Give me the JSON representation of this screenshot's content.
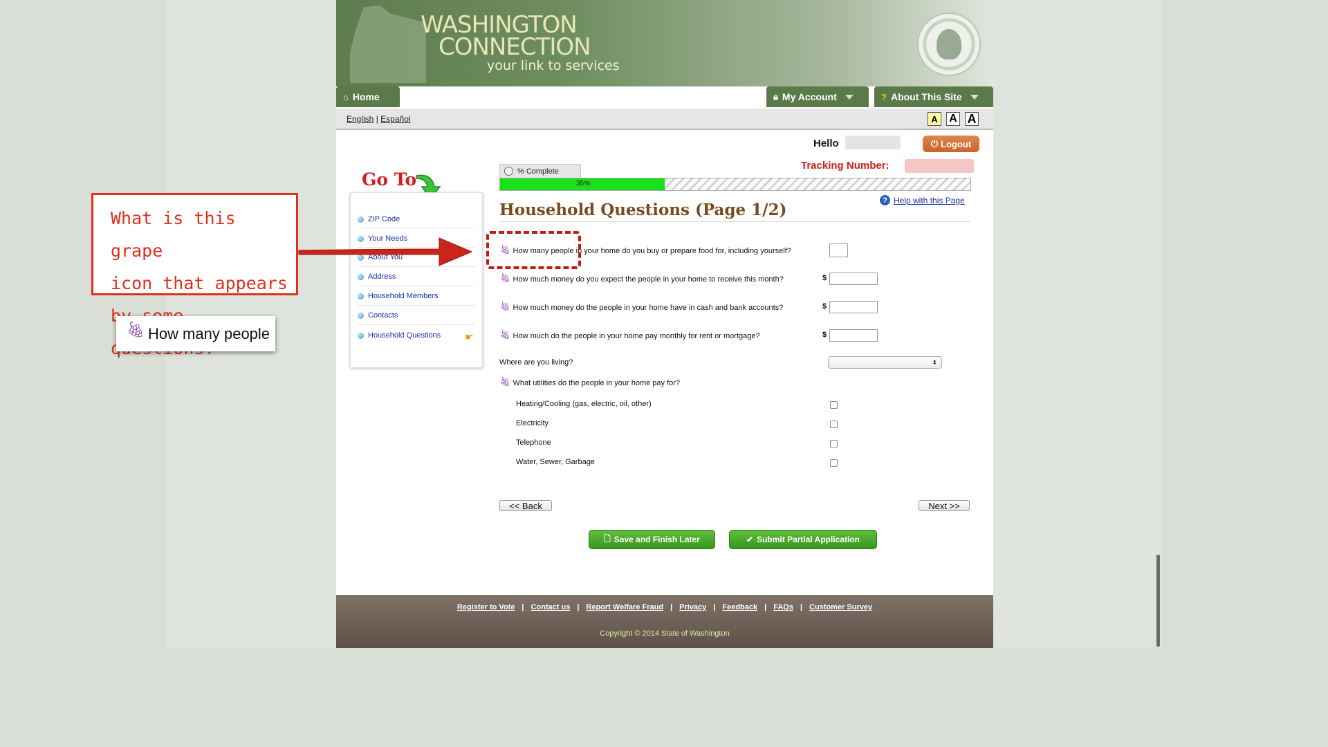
{
  "header": {
    "logo_line1": "WASHINGTON",
    "logo_line2": "CONNECTION",
    "logo_tagline": "your link to services",
    "seal_text": "THE SEAL OF THE STATE OF WASHINGTON 1889"
  },
  "nav": {
    "home": "Home",
    "my_account": "My Account",
    "about": "About This Site"
  },
  "lang": {
    "english": "English",
    "separator": "|",
    "spanish": "Español"
  },
  "text_size": [
    "A",
    "A",
    "A"
  ],
  "user": {
    "hello": "Hello",
    "logout": "Logout",
    "tracking_label": "Tracking Number:"
  },
  "sidebar": {
    "goto": "Go To",
    "items": [
      {
        "label": "ZIP Code"
      },
      {
        "label": "Your Needs"
      },
      {
        "label": "About You"
      },
      {
        "label": "Address"
      },
      {
        "label": "Household Members"
      },
      {
        "label": "Contacts"
      },
      {
        "label": "Household Questions"
      }
    ]
  },
  "progress": {
    "tab_label": "% Complete",
    "value_text": "35%",
    "fraction": 0.35
  },
  "help_link": "Help with this Page",
  "page_title": "Household Questions (Page 1/2)",
  "questions": [
    {
      "text": "How many people in your home do you buy or prepare food for, including yourself?"
    },
    {
      "text": "How much money do you expect the people in your home to receive this month?",
      "prefix": "$"
    },
    {
      "text": "How much money do the people in your home have in cash and bank accounts?",
      "prefix": "$"
    },
    {
      "text": "How much do the people in your home pay monthly for rent or mortgage?",
      "prefix": "$"
    }
  ],
  "living": {
    "label": "Where are you living?",
    "selected": ""
  },
  "utilities": {
    "label": "What utilities do the people in your home pay for?",
    "options": [
      {
        "label": "Heating/Cooling (gas, electric, oil, other)",
        "checked": false
      },
      {
        "label": "Electricity",
        "checked": false
      },
      {
        "label": "Telephone",
        "checked": false
      },
      {
        "label": "Water, Sewer, Garbage",
        "checked": false
      }
    ]
  },
  "buttons": {
    "back": "<< Back",
    "next": "Next >>",
    "save": "Save and Finish Later",
    "submit": "Submit Partial Application"
  },
  "footer": {
    "links": [
      "Register to Vote",
      "Contact us",
      "Report Welfare Fraud",
      "Privacy",
      "Feedback",
      "FAQs",
      "Customer Survey"
    ],
    "separator": "|",
    "copyright": "Copyright © 2014 State of Washington"
  },
  "annotation": {
    "callout_lines": [
      "What is this grape",
      "icon that appears",
      "by some questions?"
    ],
    "zoom_text": "How many people"
  },
  "colors": {
    "brand_green": "#5b7a4a",
    "title_brown": "#7a4a1c",
    "annotation_red": "#e0301c",
    "progress_green": "#19e019"
  },
  "icons": {
    "grape": "grape-icon",
    "home": "home-icon",
    "lock": "lock-icon",
    "question": "question-icon",
    "power": "power-icon",
    "hand": "pointing-hand-icon"
  }
}
